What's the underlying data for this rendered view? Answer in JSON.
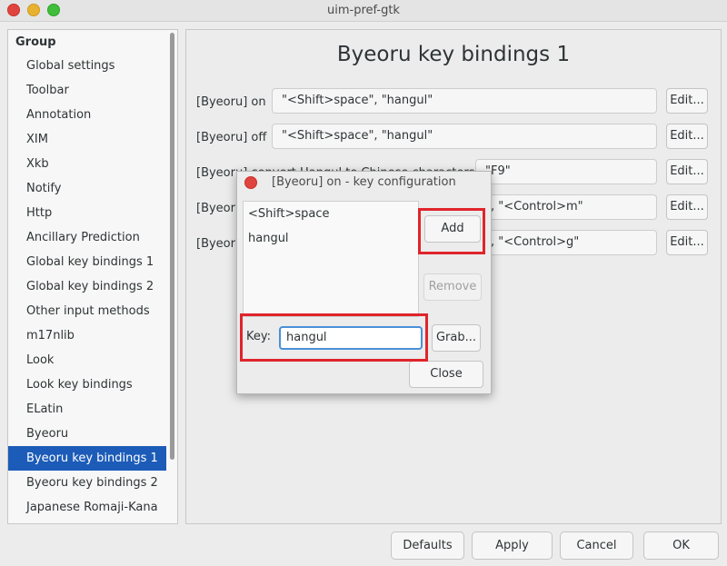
{
  "window": {
    "title": "uim-pref-gtk"
  },
  "sidebar": {
    "header": "Group",
    "items": [
      {
        "label": "Global settings"
      },
      {
        "label": "Toolbar"
      },
      {
        "label": "Annotation"
      },
      {
        "label": "XIM"
      },
      {
        "label": "Xkb"
      },
      {
        "label": "Notify"
      },
      {
        "label": "Http"
      },
      {
        "label": "Ancillary Prediction"
      },
      {
        "label": "Global key bindings 1"
      },
      {
        "label": "Global key bindings 2"
      },
      {
        "label": "Other input methods"
      },
      {
        "label": "m17nlib"
      },
      {
        "label": "Look"
      },
      {
        "label": "Look key bindings"
      },
      {
        "label": "ELatin"
      },
      {
        "label": "Byeoru"
      },
      {
        "label": "Byeoru key bindings 1",
        "selected": true
      },
      {
        "label": "Byeoru key bindings 2"
      },
      {
        "label": "Japanese Romaji-Kana"
      }
    ]
  },
  "main": {
    "title": "Byeoru key bindings 1",
    "rows": [
      {
        "label": "[Byeoru] on",
        "value": "\"<Shift>space\", \"hangul\"",
        "edit": "Edit..."
      },
      {
        "label": "[Byeoru] off",
        "value": "\"<Shift>space\", \"hangul\"",
        "edit": "Edit..."
      },
      {
        "label": "[Byeoru] convert Hangul to Chinese characters",
        "value": "\"F9\"",
        "edit": "Edit..."
      },
      {
        "label": "[Byeoru]",
        "value": "\", \"<Control>m\"",
        "edit": "Edit..."
      },
      {
        "label": "[Byeoru]",
        "value": "\", \"<Control>g\"",
        "edit": "Edit..."
      }
    ]
  },
  "buttons": {
    "defaults": "Defaults",
    "apply": "Apply",
    "cancel": "Cancel",
    "ok": "OK"
  },
  "dialog": {
    "title": "[Byeoru] on - key configuration",
    "keys": [
      "<Shift>space",
      "hangul"
    ],
    "add": "Add",
    "remove": "Remove",
    "key_label": "Key:",
    "key_value": "hangul",
    "grab": "Grab...",
    "close": "Close"
  },
  "colors": {
    "highlight": "#e0242b",
    "selection": "#1c5cb8",
    "focus": "#4a90d9"
  }
}
